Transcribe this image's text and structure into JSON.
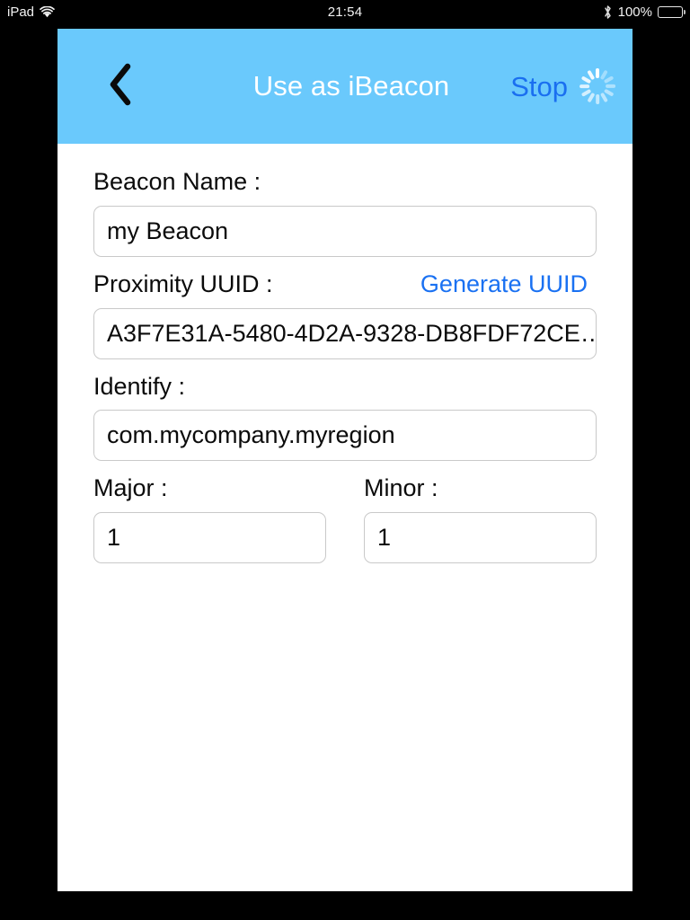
{
  "status_bar": {
    "device": "iPad",
    "wifi_icon": "wifi-icon",
    "time": "21:54",
    "bluetooth_icon": "bluetooth-icon",
    "battery_percent": "100%",
    "battery_icon": "battery-full-icon"
  },
  "nav": {
    "back_icon": "chevron-left-icon",
    "title": "Use as iBeacon",
    "action_label": "Stop",
    "spinner_icon": "activity-indicator-icon",
    "background_color": "#6ac9fc",
    "action_color": "#1a6ff0",
    "title_color": "#ffffff"
  },
  "form": {
    "beacon_name": {
      "label": "Beacon Name :",
      "value": "my Beacon",
      "placeholder": "Beacon Name"
    },
    "proximity_uuid": {
      "label": "Proximity UUID :",
      "generate_label": "Generate UUID",
      "generate_color": "#1a71f2",
      "value": "A3F7E31A-5480-4D2A-9328-DB8FDF72CE…",
      "placeholder": "Proximity UUID"
    },
    "identify": {
      "label": "Identify :",
      "value": "com.mycompany.myregion",
      "placeholder": "Identify"
    },
    "major": {
      "label": "Major :",
      "value": "1",
      "placeholder": "Major"
    },
    "minor": {
      "label": "Minor :",
      "value": "1",
      "placeholder": "Minor"
    }
  }
}
